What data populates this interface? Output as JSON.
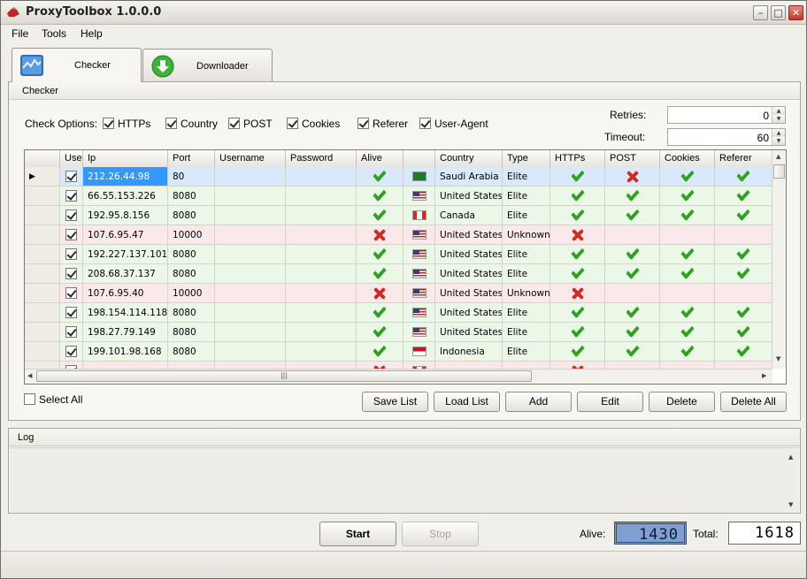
{
  "window": {
    "title": "ProxyToolbox 1.0.0.0"
  },
  "menu": [
    "File",
    "Tools",
    "Help"
  ],
  "tabs": [
    {
      "label": "Checker",
      "active": true,
      "icon": "chart-icon"
    },
    {
      "label": "Downloader",
      "active": false,
      "icon": "download-arrow-icon"
    }
  ],
  "checker": {
    "group_title": "Checker",
    "options_label": "Check Options:",
    "options": [
      {
        "label": "HTTPs",
        "checked": true
      },
      {
        "label": "Country",
        "checked": true
      },
      {
        "label": "POST",
        "checked": true
      },
      {
        "label": "Cookies",
        "checked": true
      },
      {
        "label": "Referer",
        "checked": true
      },
      {
        "label": "User-Agent",
        "checked": true
      }
    ],
    "retries_label": "Retries:",
    "retries": "0",
    "timeout_label": "Timeout:",
    "timeout": "60",
    "columns": [
      "Use",
      "Ip",
      "Port",
      "Username",
      "Password",
      "Alive",
      "",
      "Country",
      "Type",
      "HTTPs",
      "POST",
      "Cookies",
      "Referer"
    ],
    "rows": [
      {
        "ip": "212.26.44.98",
        "port": "80",
        "alive": true,
        "flag": "sa",
        "country": "Saudi Arabia",
        "type": "Elite",
        "https": "ok",
        "post": "no",
        "cookies": "ok",
        "referer": "ok",
        "selected": true
      },
      {
        "ip": "66.55.153.226",
        "port": "8080",
        "alive": true,
        "flag": "us",
        "country": "United States",
        "type": "Elite",
        "https": "ok",
        "post": "ok",
        "cookies": "ok",
        "referer": "ok"
      },
      {
        "ip": "192.95.8.156",
        "port": "8080",
        "alive": true,
        "flag": "ca",
        "country": "Canada",
        "type": "Elite",
        "https": "ok",
        "post": "ok",
        "cookies": "ok",
        "referer": "ok"
      },
      {
        "ip": "107.6.95.47",
        "port": "10000",
        "alive": false,
        "flag": "us",
        "country": "United States",
        "type": "Unknown",
        "https": "no",
        "post": "",
        "cookies": "",
        "referer": ""
      },
      {
        "ip": "192.227.137.101",
        "port": "8080",
        "alive": true,
        "flag": "us",
        "country": "United States",
        "type": "Elite",
        "https": "ok",
        "post": "ok",
        "cookies": "ok",
        "referer": "ok"
      },
      {
        "ip": "208.68.37.137",
        "port": "8080",
        "alive": true,
        "flag": "us",
        "country": "United States",
        "type": "Elite",
        "https": "ok",
        "post": "ok",
        "cookies": "ok",
        "referer": "ok"
      },
      {
        "ip": "107.6.95.40",
        "port": "10000",
        "alive": false,
        "flag": "us",
        "country": "United States",
        "type": "Unknown",
        "https": "no",
        "post": "",
        "cookies": "",
        "referer": ""
      },
      {
        "ip": "198.154.114.118",
        "port": "8080",
        "alive": true,
        "flag": "us",
        "country": "United States",
        "type": "Elite",
        "https": "ok",
        "post": "ok",
        "cookies": "ok",
        "referer": "ok"
      },
      {
        "ip": "198.27.79.149",
        "port": "8080",
        "alive": true,
        "flag": "us",
        "country": "United States",
        "type": "Elite",
        "https": "ok",
        "post": "ok",
        "cookies": "ok",
        "referer": "ok"
      },
      {
        "ip": "199.101.98.168",
        "port": "8080",
        "alive": true,
        "flag": "id",
        "country": "Indonesia",
        "type": "Elite",
        "https": "ok",
        "post": "ok",
        "cookies": "ok",
        "referer": "ok"
      },
      {
        "ip": "",
        "port": "",
        "alive": false,
        "flag": "ca",
        "country": "",
        "type": "",
        "https": "no",
        "post": "",
        "cookies": "",
        "referer": ""
      }
    ],
    "select_all_label": "Select All",
    "buttons": {
      "save": "Save List",
      "load": "Load List",
      "add": "Add",
      "edit": "Edit",
      "delete": "Delete",
      "delete_all": "Delete All"
    }
  },
  "log": {
    "title": "Log"
  },
  "controls": {
    "start": "Start",
    "stop": "Stop",
    "alive_label": "Alive:",
    "alive_count": "1430",
    "total_label": "Total:",
    "total_count": "1618"
  }
}
